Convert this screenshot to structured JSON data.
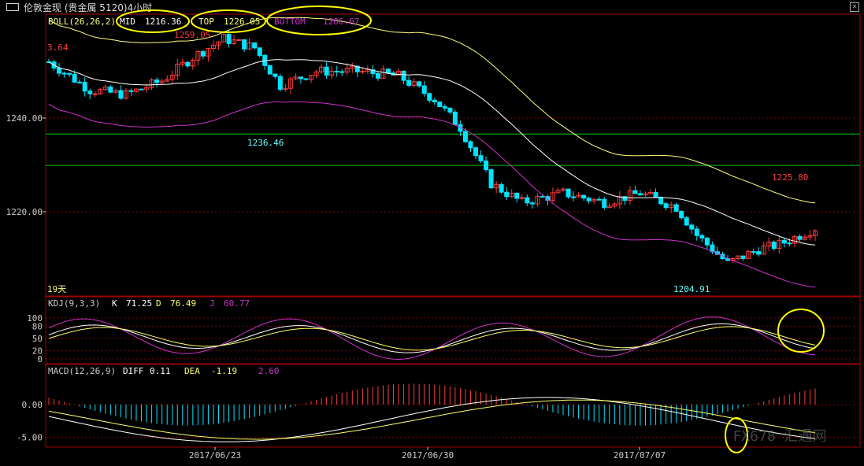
{
  "window": {
    "title": "伦敦金现 (贵金属 5120)4小时",
    "close_icon": "close-icon"
  },
  "colors": {
    "up": "#ff3b3b",
    "down": "#00e5ff",
    "boll_upper": "#ffff80",
    "boll_mid": "#ffffff",
    "boll_lower": "#cc33cc",
    "hline": "#00cc00",
    "grid": "#800000",
    "frame": "#a00000",
    "k": "#ffffff",
    "d": "#ffff66",
    "j": "#cc33cc",
    "annotation_circle": "#ffff00"
  },
  "main_panel": {
    "indicator": "BOLL(26,26,2)",
    "mid_label": "MID",
    "mid_value": "1216.36",
    "top_label": "TOP",
    "top_value": "1226.05",
    "bottom_label": "BOTTOM",
    "bottom_value": "1206.67",
    "price_labels": [
      "1240.00",
      "1220.00"
    ],
    "annotations": {
      "left_partial": "3.64",
      "high": "1259.05",
      "low1": "1236.46",
      "low2": "1204.91",
      "high2": "1225.80",
      "days": "19天"
    }
  },
  "kdj_panel": {
    "indicator": "KDJ(9,3,3)",
    "k_label": "K",
    "k_value": "71.25",
    "d_label": "D",
    "d_value": "76.49",
    "j_label": "J",
    "j_value": "60.77",
    "ticks": [
      "100",
      "80",
      "50",
      "20",
      "0"
    ]
  },
  "macd_panel": {
    "indicator": "MACD(12,26,9)",
    "diff_label": "DIFF",
    "diff_value": "0.11",
    "dea_label": "DEA",
    "dea_value": "-1.19",
    "macd_value": "2.60",
    "ticks": [
      "0.00",
      "-5.00"
    ]
  },
  "x_axis": {
    "dates": [
      "2017/06/23",
      "2017/06/30",
      "2017/07/07"
    ]
  },
  "watermark": "FX678 汇通网",
  "chart_data": [
    {
      "type": "candlestick",
      "title": "伦敦金现 4小时",
      "indicator": "BOLL(26,26,2)",
      "ylabel_ticks": [
        1240,
        1220
      ],
      "annotated_values": {
        "high": 1259.05,
        "low_1": 1236.46,
        "low_2": 1204.91,
        "high_2": 1225.8
      },
      "boll": {
        "mid": 1216.36,
        "top": 1226.05,
        "bottom": 1206.67
      },
      "horizontal_lines": [
        1236.6,
        1229.9
      ]
    },
    {
      "type": "line",
      "indicator": "KDJ(9,3,3)",
      "series": [
        {
          "name": "K",
          "last": 71.25
        },
        {
          "name": "D",
          "last": 76.49
        },
        {
          "name": "J",
          "last": 60.77
        }
      ],
      "ylim": [
        0,
        100
      ]
    },
    {
      "type": "bar",
      "indicator": "MACD(12,26,9)",
      "series": [
        {
          "name": "DIFF",
          "last": 0.11
        },
        {
          "name": "DEA",
          "last": -1.19
        },
        {
          "name": "MACD",
          "last": 2.6
        }
      ]
    }
  ]
}
